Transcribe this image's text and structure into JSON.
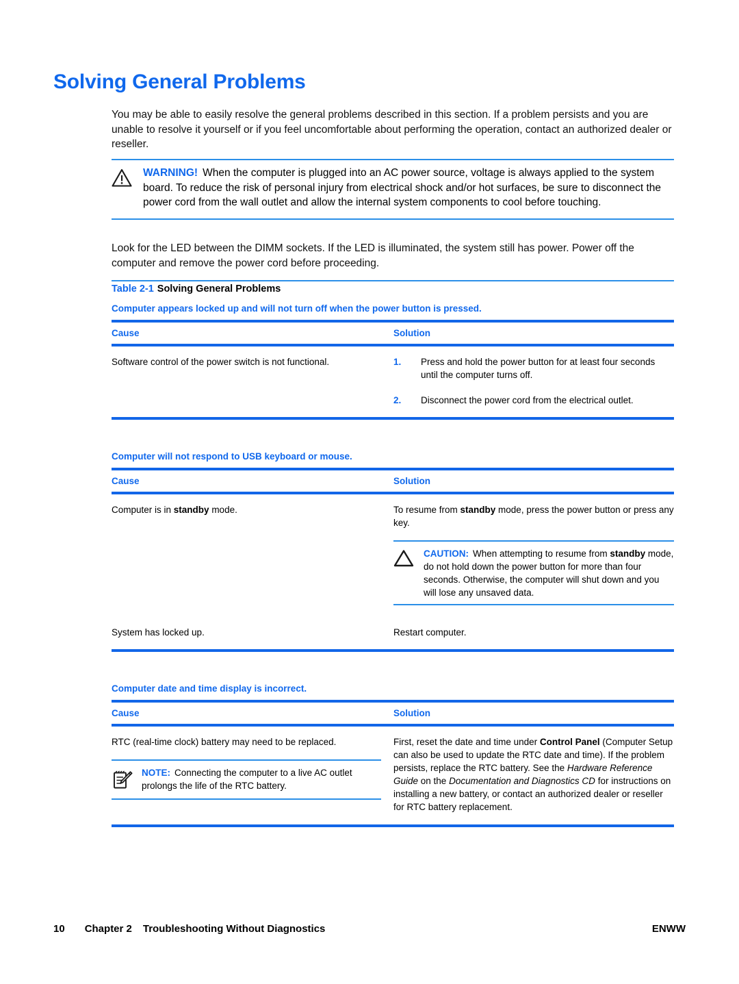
{
  "page": {
    "heading": "Solving General Problems",
    "intro": "You may be able to easily resolve the general problems described in this section. If a problem persists and you are unable to resolve it yourself or if you feel uncomfortable about performing the operation, contact an authorized dealer or reseller."
  },
  "warning": {
    "icon": "warning-triangle-icon",
    "label": "WARNING!",
    "text": "When the computer is plugged into an AC power source, voltage is always applied to the system board. To reduce the risk of personal injury from electrical shock and/or hot surfaces, be sure to disconnect the power cord from the wall outlet and allow the internal system components to cool before touching."
  },
  "led_note": {
    "text": "Look for the LED between the DIMM sockets. If the LED is illuminated, the system still has power. Power off the computer and remove the power cord before proceeding."
  },
  "table": {
    "caption_number": "Table 2-1",
    "caption_title": "Solving General Problems",
    "column_headers": {
      "cause": "Cause",
      "solution": "Solution"
    },
    "sections": [
      {
        "title": "Computer appears locked up and will not turn off when the power button is pressed.",
        "rows": [
          {
            "cause": "Software control of the power switch is not functional.",
            "solution_steps": [
              {
                "num": "1.",
                "text": "Press and hold the power button for at least four seconds until the computer turns off."
              },
              {
                "num": "2.",
                "text": "Disconnect the power cord from the electrical outlet."
              }
            ]
          }
        ]
      },
      {
        "title": "Computer will not respond to USB keyboard or mouse.",
        "rows": [
          {
            "cause_prefix": "Computer is in ",
            "cause_bold": "standby",
            "cause_suffix": " mode.",
            "solution_prefix": "To resume from ",
            "solution_bold": "standby",
            "solution_suffix": " mode, press the power button or press any key.",
            "caution": {
              "icon": "caution-triangle-icon",
              "label": "CAUTION:",
              "text_prefix": "When attempting to resume from ",
              "text_bold": "standby",
              "text_suffix": " mode, do not hold down the power button for more than four seconds. Otherwise, the computer will shut down and you will lose any unsaved data."
            }
          },
          {
            "cause": "System has locked up.",
            "solution": "Restart computer."
          }
        ]
      },
      {
        "title": "Computer date and time display is incorrect.",
        "rows": [
          {
            "cause": "RTC (real-time clock) battery may need to be replaced.",
            "note": {
              "icon": "note-pencil-icon",
              "label": "NOTE:",
              "text": "Connecting the computer to a live AC outlet prolongs the life of the RTC battery."
            },
            "solution_part1": "First, reset the date and time under ",
            "solution_bold1": "Control Panel",
            "solution_part2": " (Computer Setup can also be used to update the RTC date and time). If the problem persists, replace the RTC battery. See the ",
            "solution_italic1": "Hardware Reference Guide",
            "solution_part3": " on the ",
            "solution_italic2": "Documentation and Diagnostics CD",
            "solution_part4": " for instructions on installing a new battery, or contact an authorized dealer or reseller for RTC battery replacement."
          }
        ]
      }
    ]
  },
  "footer": {
    "page_number": "10",
    "chapter": "Chapter 2",
    "chapter_title": "Troubleshooting Without Diagnostics",
    "locale": "ENWW"
  },
  "colors": {
    "accent_blue": "#1068ec",
    "rule_blue": "#1266e8",
    "thin_rule_blue": "#2b8fe8"
  }
}
